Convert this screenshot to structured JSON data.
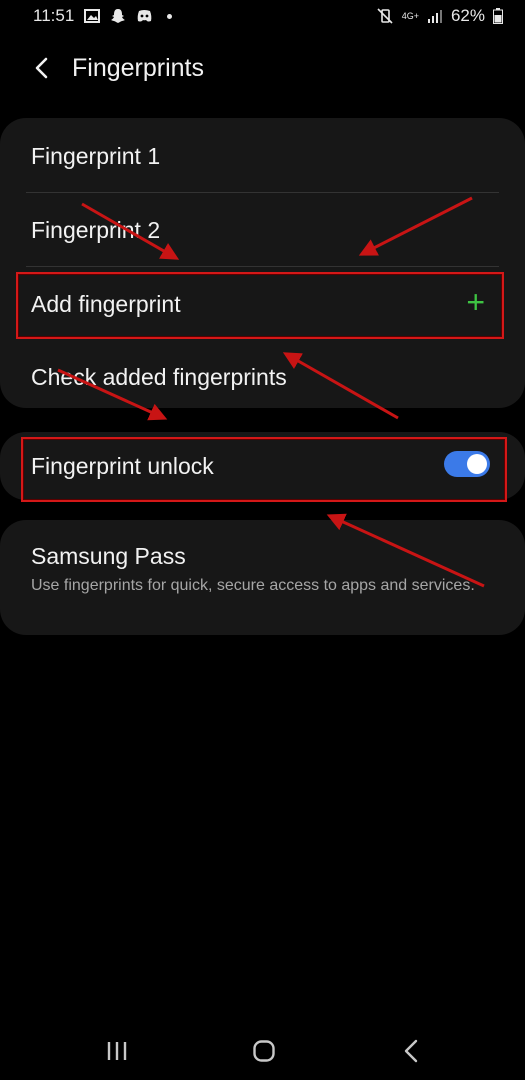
{
  "status_bar": {
    "time": "11:51",
    "left_icons": [
      "image-icon",
      "snapchat-icon",
      "discord-icon",
      "dot-icon"
    ],
    "network": "4G+",
    "battery": "62%",
    "battery_icon": "battery-icon",
    "mute_icon": "vibrate-off-icon"
  },
  "header": {
    "title": "Fingerprints",
    "back_icon": "back-arrow-icon"
  },
  "fingerprint_list": {
    "items": [
      "Fingerprint 1",
      "Fingerprint 2"
    ],
    "add_label": "Add fingerprint",
    "add_icon": "plus-icon",
    "check_label": "Check added fingerprints"
  },
  "unlock": {
    "label": "Fingerprint unlock",
    "toggle_on": true
  },
  "samsung_pass": {
    "title": "Samsung Pass",
    "description": "Use fingerprints for quick, secure access to apps and services."
  },
  "colors": {
    "accent_green": "#3ec443",
    "toggle_blue": "#3b7ae8",
    "annotation_red": "#d41818",
    "card_bg": "#171717"
  },
  "nav_bar": [
    "recents-icon",
    "home-icon",
    "back-icon"
  ]
}
